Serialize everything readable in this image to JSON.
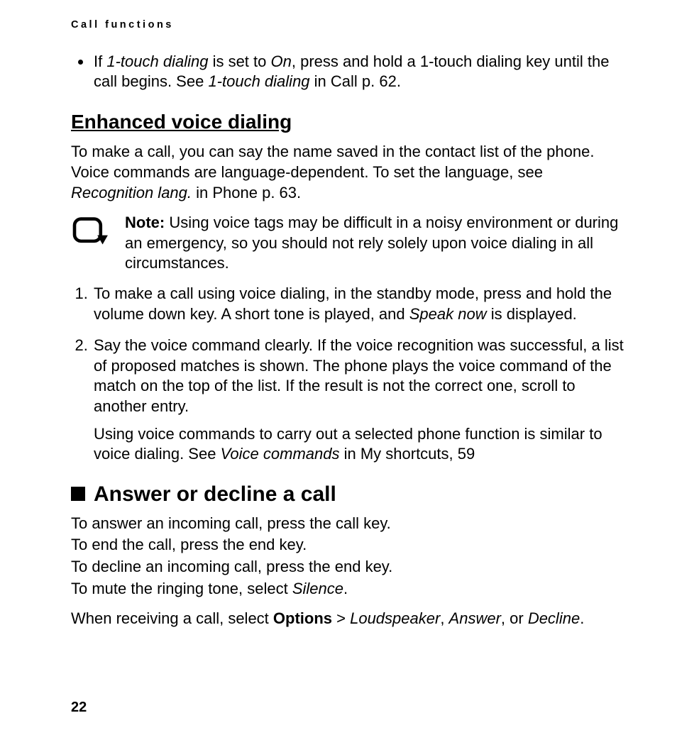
{
  "running_head": "Call functions",
  "bullet": {
    "pre": "If ",
    "i1": "1-touch dialing",
    "mid1": " is set to ",
    "i2": "On",
    "mid2": ", press and hold a 1-touch dialing key until the call begins. See ",
    "i3": "1-touch dialing",
    "tail": " in Call p. 62."
  },
  "evd": {
    "heading": "Enhanced voice dialing",
    "intro_pre": "To make a call, you can say the name saved in the contact list of the phone. Voice commands are language-dependent. To set the language, see ",
    "intro_i": "Recognition lang.",
    "intro_post": " in Phone p. 63.",
    "note_label": "Note:",
    "note_body": " Using voice tags may be difficult in a noisy environment or during an emergency, so you should not rely solely upon voice dialing in all circumstances.",
    "steps": [
      {
        "pre": "To make a call using voice dialing, in the standby mode, press and hold the volume down key. A short tone is played, and ",
        "i": "Speak now",
        "post": " is displayed."
      },
      {
        "main": "Say the voice command clearly. If the voice recognition was successful, a list of proposed matches is shown. The phone plays the voice command of the match on the top of the list. If the result is not the correct one, scroll to another entry.",
        "sub_pre": "Using voice commands to carry out a selected phone function is similar to voice dialing. See ",
        "sub_i": "Voice commands",
        "sub_post": " in My shortcuts, 59"
      }
    ]
  },
  "answer": {
    "heading": "Answer or decline a call",
    "p1": "To answer an incoming call, press the call key.",
    "p2": "To end the call, press the end key.",
    "p3": "To decline an incoming call, press the end key.",
    "p4_pre": "To mute the ringing tone, select ",
    "p4_i": "Silence",
    "p4_post": ".",
    "p5_pre": "When receiving a call, select ",
    "p5_b": "Options",
    "p5_mid": " > ",
    "p5_i1": "Loudspeaker",
    "p5_c1": ", ",
    "p5_i2": "Answer",
    "p5_c2": ", or ",
    "p5_i3": "Decline",
    "p5_post": "."
  },
  "page_number": "22"
}
